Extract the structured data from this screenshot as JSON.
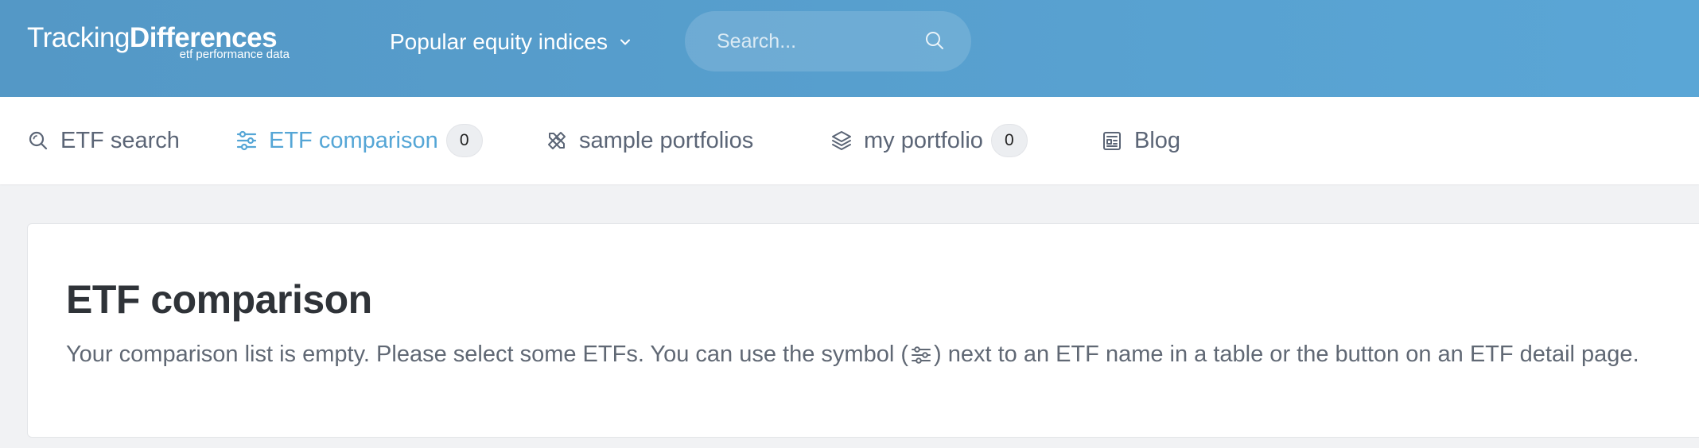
{
  "header": {
    "logo": {
      "light": "Tracking",
      "bold": "Differences",
      "tagline": "etf performance data"
    },
    "indices_dropdown": {
      "label": "Popular equity indices",
      "icon": "chevron-down-icon"
    },
    "search": {
      "placeholder": "Search...",
      "icon": "search-icon"
    }
  },
  "nav": {
    "items": [
      {
        "label": "ETF search",
        "icon": "search-icon",
        "active": false
      },
      {
        "label": "ETF comparison",
        "icon": "sliders-icon",
        "active": true,
        "badge": "0"
      },
      {
        "label": "sample portfolios",
        "icon": "ruler-pencil-icon",
        "active": false
      },
      {
        "label": "my portfolio",
        "icon": "layers-icon",
        "active": false,
        "badge": "0"
      },
      {
        "label": "Blog",
        "icon": "news-icon",
        "active": false
      }
    ]
  },
  "main": {
    "title": "ETF comparison",
    "message_before": "Your comparison list is empty. Please select some ETFs. You can use the symbol (",
    "message_after": ") next to an ETF name in a table or the button on an ETF detail page."
  },
  "colors": {
    "header_start": "#5498c6",
    "header_end": "#5aa6d6",
    "active_nav": "#55a6d6",
    "nav_text": "#5b6576",
    "title_text": "#2f3338"
  }
}
